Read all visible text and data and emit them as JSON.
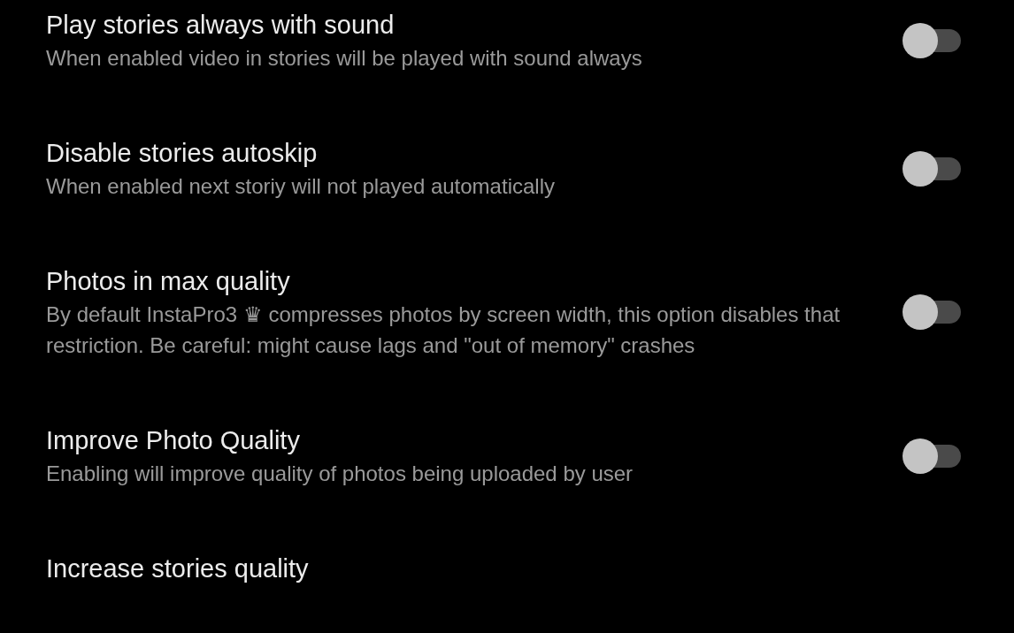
{
  "settings": [
    {
      "title": "Play stories always with sound",
      "description": "When enabled video in stories will be played with sound always",
      "on": false
    },
    {
      "title": "Disable stories autoskip",
      "description": "When enabled next storiy will not played automatically",
      "on": false
    },
    {
      "title": "Photos in max quality",
      "description": "By default InstaPro3 ♛ compresses photos by screen width, this option disables that restriction. Be careful: might cause lags and \"out of memory\" crashes",
      "on": false
    },
    {
      "title": "Improve Photo Quality",
      "description": "Enabling will improve quality of photos being uploaded by user",
      "on": false
    },
    {
      "title": "Increase stories quality"
    }
  ]
}
